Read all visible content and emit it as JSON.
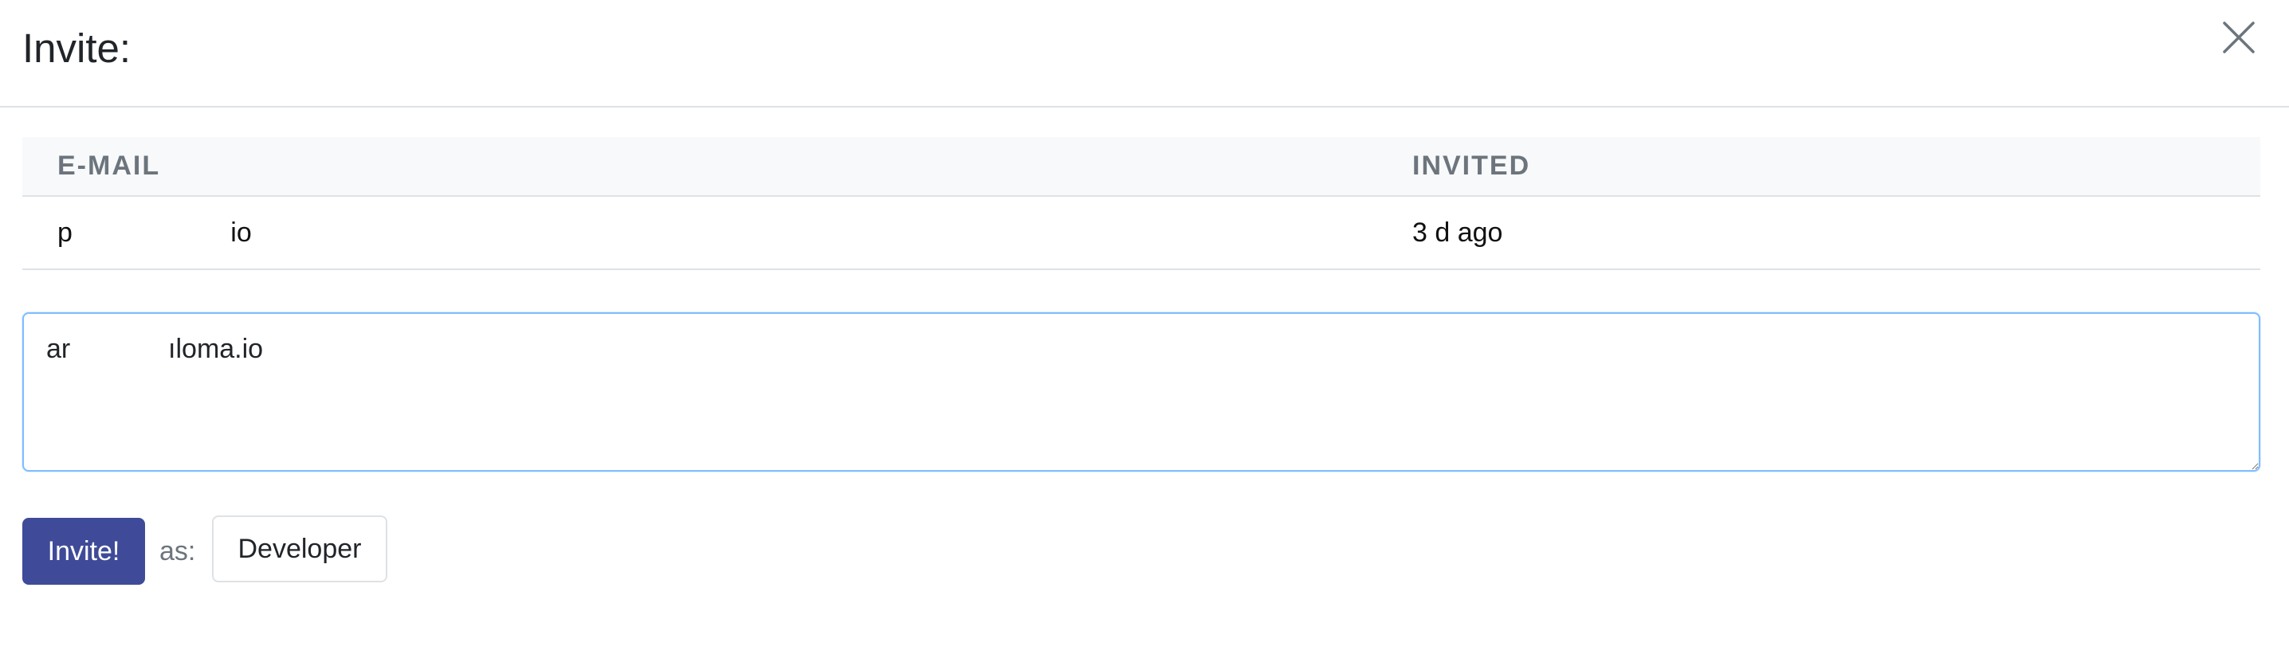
{
  "modal": {
    "title": "Invite:"
  },
  "close_icon": "close-icon",
  "table": {
    "columns": [
      "E-MAIL",
      "INVITED"
    ],
    "rows": [
      {
        "email": "p                     io",
        "invited": "3 d ago"
      }
    ]
  },
  "invite_input": {
    "value": "ar             ıloma.io"
  },
  "actions": {
    "invite_label": "Invite!",
    "as_label": "as:",
    "role_label": "Developer"
  },
  "colors": {
    "primary": "#3f4b98",
    "header_text": "#6c757d",
    "focus_border": "#80bdff"
  }
}
